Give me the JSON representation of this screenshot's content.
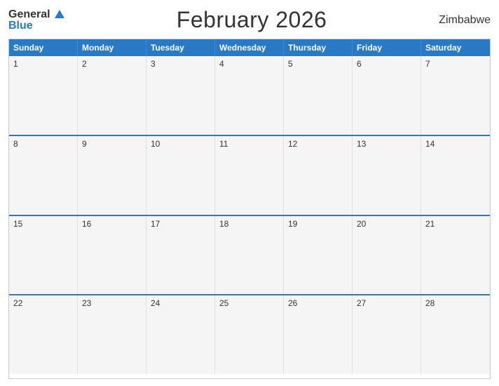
{
  "header": {
    "logo_general": "General",
    "logo_blue": "Blue",
    "title": "February 2026",
    "country": "Zimbabwe"
  },
  "calendar": {
    "days_of_week": [
      "Sunday",
      "Monday",
      "Tuesday",
      "Wednesday",
      "Thursday",
      "Friday",
      "Saturday"
    ],
    "weeks": [
      [
        {
          "day": "1",
          "empty": false
        },
        {
          "day": "2",
          "empty": false
        },
        {
          "day": "3",
          "empty": false
        },
        {
          "day": "4",
          "empty": false
        },
        {
          "day": "5",
          "empty": false
        },
        {
          "day": "6",
          "empty": false
        },
        {
          "day": "7",
          "empty": false
        }
      ],
      [
        {
          "day": "8",
          "empty": false
        },
        {
          "day": "9",
          "empty": false
        },
        {
          "day": "10",
          "empty": false
        },
        {
          "day": "11",
          "empty": false
        },
        {
          "day": "12",
          "empty": false
        },
        {
          "day": "13",
          "empty": false
        },
        {
          "day": "14",
          "empty": false
        }
      ],
      [
        {
          "day": "15",
          "empty": false
        },
        {
          "day": "16",
          "empty": false
        },
        {
          "day": "17",
          "empty": false
        },
        {
          "day": "18",
          "empty": false
        },
        {
          "day": "19",
          "empty": false
        },
        {
          "day": "20",
          "empty": false
        },
        {
          "day": "21",
          "empty": false
        }
      ],
      [
        {
          "day": "22",
          "empty": false
        },
        {
          "day": "23",
          "empty": false
        },
        {
          "day": "24",
          "empty": false
        },
        {
          "day": "25",
          "empty": false
        },
        {
          "day": "26",
          "empty": false
        },
        {
          "day": "27",
          "empty": false
        },
        {
          "day": "28",
          "empty": false
        }
      ]
    ]
  }
}
